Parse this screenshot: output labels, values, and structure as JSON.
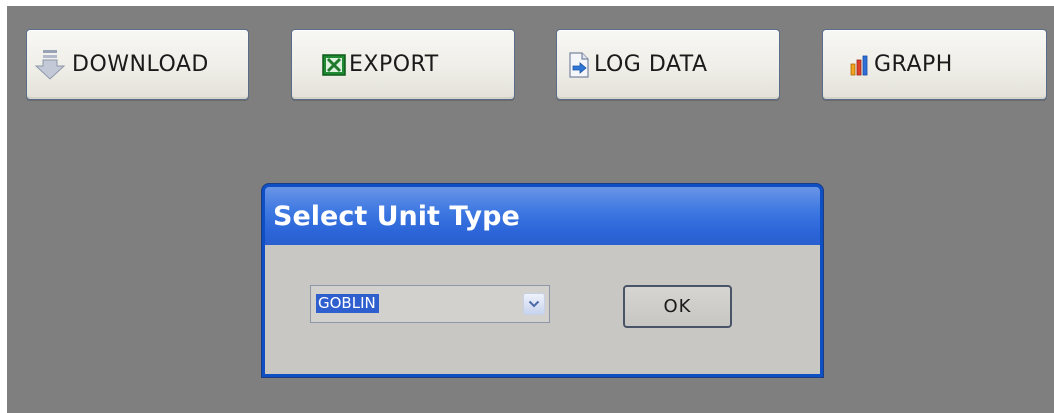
{
  "toolbar": {
    "download_label": "DOWNLOAD",
    "export_label": "EXPORT",
    "log_data_label": "LOG DATA",
    "graph_label": "GRAPH",
    "icons": {
      "download": "download-arrow-icon",
      "export": "excel-icon",
      "log_data": "log-document-icon",
      "graph": "bar-chart-icon"
    }
  },
  "dialog": {
    "title": "Select Unit Type",
    "unit_select": {
      "value": "GOBLIN"
    },
    "ok_label": "OK"
  },
  "colors": {
    "background": "#7f7f7f",
    "dialog_title_bar": "#3f79e2",
    "selection_highlight": "#2f5fcf"
  }
}
